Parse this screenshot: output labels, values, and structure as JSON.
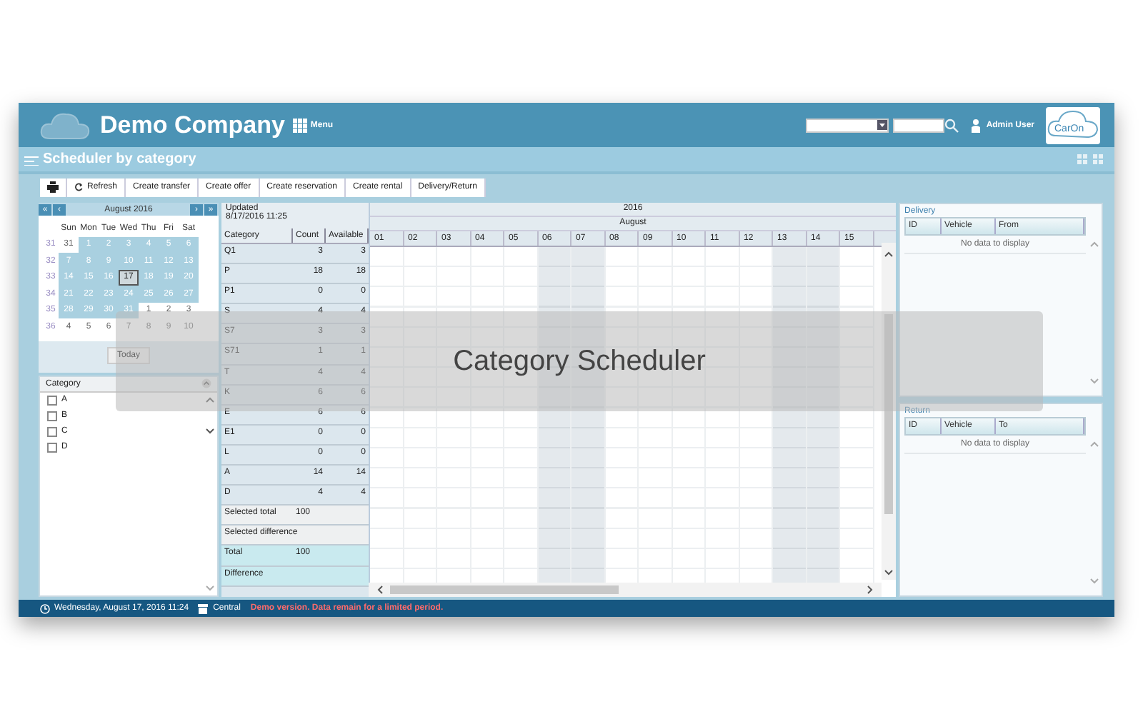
{
  "header": {
    "company": "Demo Company",
    "menu": "Menu",
    "user": "Admin User",
    "logo_text": "CarOn"
  },
  "page_title": "Scheduler by category",
  "toolbar": [
    {
      "kind": "print"
    },
    {
      "kind": "refresh",
      "label": "Refresh"
    },
    {
      "kind": "text",
      "label": "Create transfer"
    },
    {
      "kind": "text",
      "label": "Create offer"
    },
    {
      "kind": "text",
      "label": "Create reservation"
    },
    {
      "kind": "text",
      "label": "Create rental"
    },
    {
      "kind": "text",
      "label": "Delivery/Return"
    }
  ],
  "calendar": {
    "nav": [
      "«",
      "‹",
      "›",
      "»"
    ],
    "month": "August 2016",
    "weekdays": [
      "Sun",
      "Mon",
      "Tue",
      "Wed",
      "Thu",
      "Fri",
      "Sat"
    ],
    "weeks": [
      {
        "number": "31",
        "days": [
          {
            "day": "31",
            "other_month": true,
            "today": false
          },
          {
            "day": "1",
            "other_month": false,
            "today": false
          },
          {
            "day": "2",
            "other_month": false,
            "today": false
          },
          {
            "day": "3",
            "other_month": false,
            "today": false
          },
          {
            "day": "4",
            "other_month": false,
            "today": false
          },
          {
            "day": "5",
            "other_month": false,
            "today": false
          },
          {
            "day": "6",
            "other_month": false,
            "today": false
          }
        ]
      },
      {
        "number": "32",
        "days": [
          {
            "day": "7",
            "other_month": false,
            "today": false
          },
          {
            "day": "8",
            "other_month": false,
            "today": false
          },
          {
            "day": "9",
            "other_month": false,
            "today": false
          },
          {
            "day": "10",
            "other_month": false,
            "today": false
          },
          {
            "day": "11",
            "other_month": false,
            "today": false
          },
          {
            "day": "12",
            "other_month": false,
            "today": false
          },
          {
            "day": "13",
            "other_month": false,
            "today": false
          }
        ]
      },
      {
        "number": "33",
        "days": [
          {
            "day": "14",
            "other_month": false,
            "today": false
          },
          {
            "day": "15",
            "other_month": false,
            "today": false
          },
          {
            "day": "16",
            "other_month": false,
            "today": false
          },
          {
            "day": "17",
            "other_month": false,
            "today": true
          },
          {
            "day": "18",
            "other_month": false,
            "today": false
          },
          {
            "day": "19",
            "other_month": false,
            "today": false
          },
          {
            "day": "20",
            "other_month": false,
            "today": false
          }
        ]
      },
      {
        "number": "34",
        "days": [
          {
            "day": "21",
            "other_month": false,
            "today": false
          },
          {
            "day": "22",
            "other_month": false,
            "today": false
          },
          {
            "day": "23",
            "other_month": false,
            "today": false
          },
          {
            "day": "24",
            "other_month": false,
            "today": false
          },
          {
            "day": "25",
            "other_month": false,
            "today": false
          },
          {
            "day": "26",
            "other_month": false,
            "today": false
          },
          {
            "day": "27",
            "other_month": false,
            "today": false
          }
        ]
      },
      {
        "number": "35",
        "days": [
          {
            "day": "28",
            "other_month": false,
            "today": false
          },
          {
            "day": "29",
            "other_month": false,
            "today": false
          },
          {
            "day": "30",
            "other_month": false,
            "today": false
          },
          {
            "day": "31",
            "other_month": false,
            "today": false
          },
          {
            "day": "1",
            "other_month": true,
            "today": false
          },
          {
            "day": "2",
            "other_month": true,
            "today": false
          },
          {
            "day": "3",
            "other_month": true,
            "today": false
          }
        ]
      },
      {
        "number": "36",
        "days": [
          {
            "day": "4",
            "other_month": true,
            "today": false
          },
          {
            "day": "5",
            "other_month": true,
            "today": false
          },
          {
            "day": "6",
            "other_month": true,
            "today": false
          },
          {
            "day": "7",
            "other_month": true,
            "today": false
          },
          {
            "day": "8",
            "other_month": true,
            "today": false
          },
          {
            "day": "9",
            "other_month": true,
            "today": false
          },
          {
            "day": "10",
            "other_month": true,
            "today": false
          }
        ]
      }
    ],
    "today_button": "Today"
  },
  "category_filter": {
    "title": "Category",
    "items": [
      {
        "label": "A",
        "checked": false
      },
      {
        "label": "B",
        "checked": false
      },
      {
        "label": "C",
        "checked": false
      },
      {
        "label": "D",
        "checked": false
      }
    ]
  },
  "scheduler": {
    "updated_label": "Updated",
    "updated": "8/17/2016 11:25",
    "columns": [
      "Category",
      "Count",
      "Available"
    ],
    "year": "2016",
    "month": "August",
    "days": [
      {
        "label": "01",
        "weekend": false
      },
      {
        "label": "02",
        "weekend": false
      },
      {
        "label": "03",
        "weekend": false
      },
      {
        "label": "04",
        "weekend": false
      },
      {
        "label": "05",
        "weekend": false
      },
      {
        "label": "06",
        "weekend": true
      },
      {
        "label": "07",
        "weekend": true
      },
      {
        "label": "08",
        "weekend": false
      },
      {
        "label": "09",
        "weekend": false
      },
      {
        "label": "10",
        "weekend": false
      },
      {
        "label": "11",
        "weekend": false
      },
      {
        "label": "12",
        "weekend": false
      },
      {
        "label": "13",
        "weekend": true
      },
      {
        "label": "14",
        "weekend": true
      },
      {
        "label": "15",
        "weekend": false
      }
    ],
    "rows": [
      {
        "category": "Q1",
        "count": "3",
        "available": "3"
      },
      {
        "category": "P",
        "count": "18",
        "available": "18"
      },
      {
        "category": "P1",
        "count": "0",
        "available": "0"
      },
      {
        "category": "S",
        "count": "4",
        "available": "4"
      },
      {
        "category": "S7",
        "count": "3",
        "available": "3"
      },
      {
        "category": "S71",
        "count": "1",
        "available": "1"
      },
      {
        "category": "T",
        "count": "4",
        "available": "4"
      },
      {
        "category": "K",
        "count": "6",
        "available": "6"
      },
      {
        "category": "E",
        "count": "6",
        "available": "6"
      },
      {
        "category": "E1",
        "count": "0",
        "available": "0"
      },
      {
        "category": "L",
        "count": "0",
        "available": "0"
      },
      {
        "category": "A",
        "count": "14",
        "available": "14"
      },
      {
        "category": "D",
        "count": "4",
        "available": "4"
      }
    ],
    "summary": [
      {
        "kind": "selected",
        "label": "Selected total",
        "value": "100"
      },
      {
        "kind": "selected",
        "label": "Selected difference"
      },
      {
        "kind": "total",
        "label": "Total",
        "value": "100"
      },
      {
        "kind": "total",
        "label": "Difference"
      }
    ]
  },
  "delivery": {
    "title": "Delivery",
    "columns": [
      "ID",
      "Vehicle",
      "From"
    ],
    "empty": "No data to display"
  },
  "return": {
    "title": "Return",
    "columns": [
      "ID",
      "Vehicle",
      "To"
    ],
    "empty": "No data to display"
  },
  "status_bar": {
    "datetime": "Wednesday, August 17, 2016 11:24",
    "location": "Central",
    "notice": "Demo version. Data remain for a limited period."
  },
  "banner": {
    "title": "Category Scheduler"
  }
}
